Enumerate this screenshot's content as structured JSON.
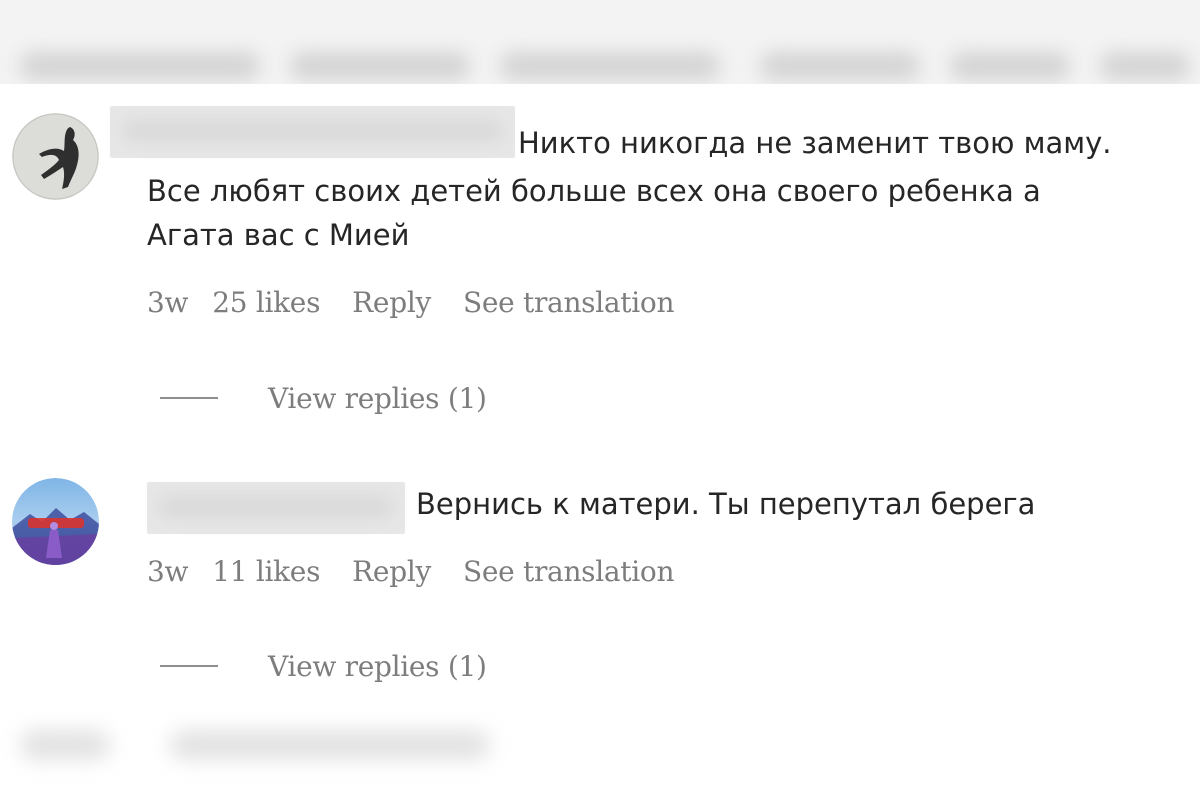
{
  "comments": [
    {
      "text_first": "Никто никогда не заменит твою маму.",
      "text_second": "Все любят своих детей больше всех она своего ребенка а",
      "text_third": "Агата вас с Мией",
      "time": "3w",
      "likes": "25 likes",
      "reply_label": "Reply",
      "translate_label": "See translation",
      "view_replies": "View replies (1)"
    },
    {
      "text_first": "Вернись к матери. Ты перепутал берега",
      "time": "3w",
      "likes": "11 likes",
      "reply_label": "Reply",
      "translate_label": "See translation",
      "view_replies": "View replies (1)"
    }
  ],
  "colors": {
    "text": "#262626",
    "meta": "#7d7d7d",
    "background": "#ffffff"
  }
}
